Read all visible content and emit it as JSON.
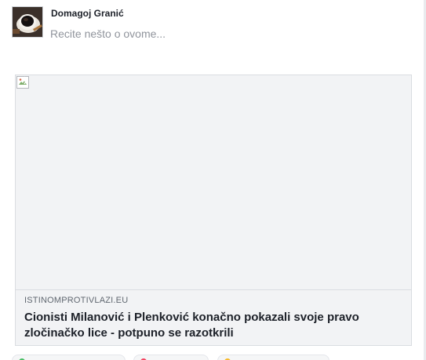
{
  "author": {
    "name": "Domagoj Granić"
  },
  "composer": {
    "placeholder": "Recite nešto o ovome..."
  },
  "link_preview": {
    "image_icon": "broken-image-icon",
    "domain": "ISTINOMPROTIVLAZI.EU",
    "title": "Cionisti Milanović i Plenković konačno pokazali svoje pravo zločinačko lice - potpuno se razotkrili"
  },
  "actions": [
    {
      "icon": "photo-icon",
      "color": "#45bd62"
    },
    {
      "icon": "tag-friends-icon",
      "color": "#f3425f"
    },
    {
      "icon": "feeling-icon",
      "color": "#f7b928"
    }
  ]
}
